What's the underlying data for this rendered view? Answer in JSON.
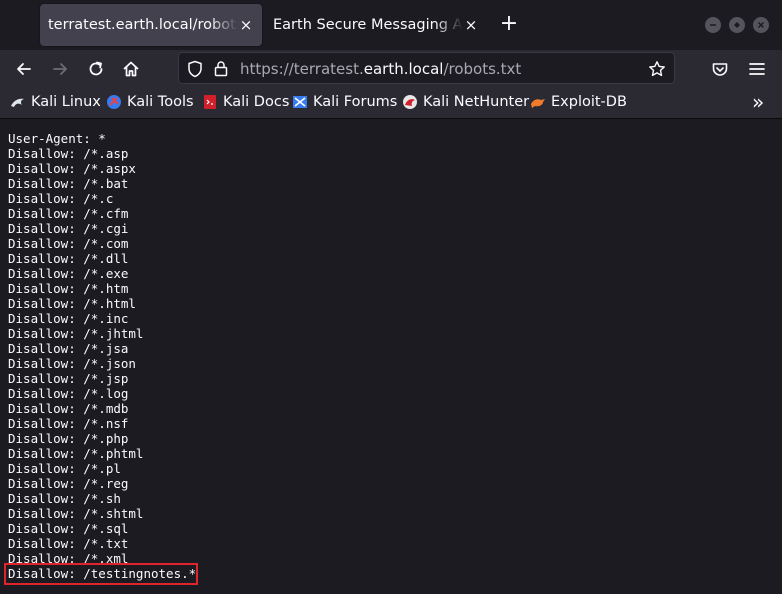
{
  "tabs": [
    {
      "title": "terratest.earth.local/robots.txt",
      "active": true
    },
    {
      "title": "Earth Secure Messaging Admin",
      "active": false
    }
  ],
  "new_tab_label": "+",
  "close_glyph": "×",
  "url": {
    "prefix": "https://",
    "subdomain": "terratest.",
    "domain": "earth.local",
    "path": "/robots.txt"
  },
  "bookmarks": [
    {
      "label": "Kali Linux",
      "icon": "kali-dragon-icon"
    },
    {
      "label": "Kali Tools",
      "icon": "kali-tools-icon"
    },
    {
      "label": "Kali Docs",
      "icon": "kali-docs-icon"
    },
    {
      "label": "Kali Forums",
      "icon": "kali-forums-icon"
    },
    {
      "label": "Kali NetHunter",
      "icon": "kali-nethunter-icon"
    },
    {
      "label": "Exploit-DB",
      "icon": "exploit-db-icon"
    }
  ],
  "bookmarks_overflow": "»",
  "robots_lines": [
    "User-Agent: *",
    "Disallow: /*.asp",
    "Disallow: /*.aspx",
    "Disallow: /*.bat",
    "Disallow: /*.c",
    "Disallow: /*.cfm",
    "Disallow: /*.cgi",
    "Disallow: /*.com",
    "Disallow: /*.dll",
    "Disallow: /*.exe",
    "Disallow: /*.htm",
    "Disallow: /*.html",
    "Disallow: /*.inc",
    "Disallow: /*.jhtml",
    "Disallow: /*.jsa",
    "Disallow: /*.json",
    "Disallow: /*.jsp",
    "Disallow: /*.log",
    "Disallow: /*.mdb",
    "Disallow: /*.nsf",
    "Disallow: /*.php",
    "Disallow: /*.phtml",
    "Disallow: /*.pl",
    "Disallow: /*.reg",
    "Disallow: /*.sh",
    "Disallow: /*.shtml",
    "Disallow: /*.sql",
    "Disallow: /*.txt",
    "Disallow: /*.xml",
    "Disallow: /testingnotes.*"
  ],
  "highlight_color": "#e0242b"
}
